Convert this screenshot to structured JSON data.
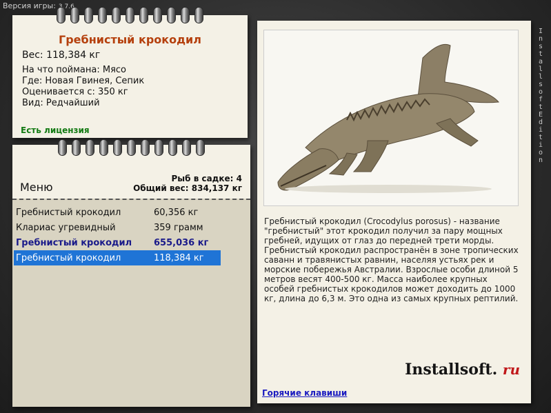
{
  "app": {
    "version_label": "Версия игры:",
    "version_number": "3.7.6"
  },
  "fish_card": {
    "title": "Гребнистый крокодил",
    "weight": "Вес: 118,384 кг",
    "caught_on": "На что поймана: Мясо",
    "where": "Где: Новая Гвинея, Сепик",
    "valued_from": "Оценивается с: 350 кг",
    "kind": "Вид: Редчайший",
    "license": "Есть лицензия"
  },
  "keepnet": {
    "count": "Рыб в садке: 4",
    "total_weight": "Общий вес: 834,137 кг",
    "menu_label": "Меню",
    "rows": [
      {
        "name": "Гребнистый крокодил",
        "weight": "60,356 кг",
        "style": "normal"
      },
      {
        "name": "Клариас угревидный",
        "weight": "359 грамм",
        "style": "normal"
      },
      {
        "name": "Гребнистый крокодил",
        "weight": "655,036 кг",
        "style": "bold"
      },
      {
        "name": "Гребнистый крокодил",
        "weight": "118,384 кг",
        "style": "selected"
      }
    ]
  },
  "description": {
    "text": "Гребнистый крокодил (Crocodylus porosus) - название \"гребнистый\" этот крокодил получил за пару мощных гребней, идущих от глаз до передней трети морды. Гребнистый крокодил распространён в зоне тропических саванн и травянистых равнин, населяя устьях рек и морские побережья Австралии. Взрослые особи длиной 5 метров весят 400-500 кг. Масса наиболее крупных особей гребнистых крокодилов может доходить до 1000 кг, длина до 6,3 м. Это одна из самых крупных рептилий.",
    "logo_main": "Installsoft.",
    "logo_ru": "ru",
    "hotkeys": "Горячие клавиши"
  },
  "side_label": "Installsoft Edition",
  "icons": {
    "photo": "crocodile-photo",
    "rings": "binder-ring-icon"
  }
}
